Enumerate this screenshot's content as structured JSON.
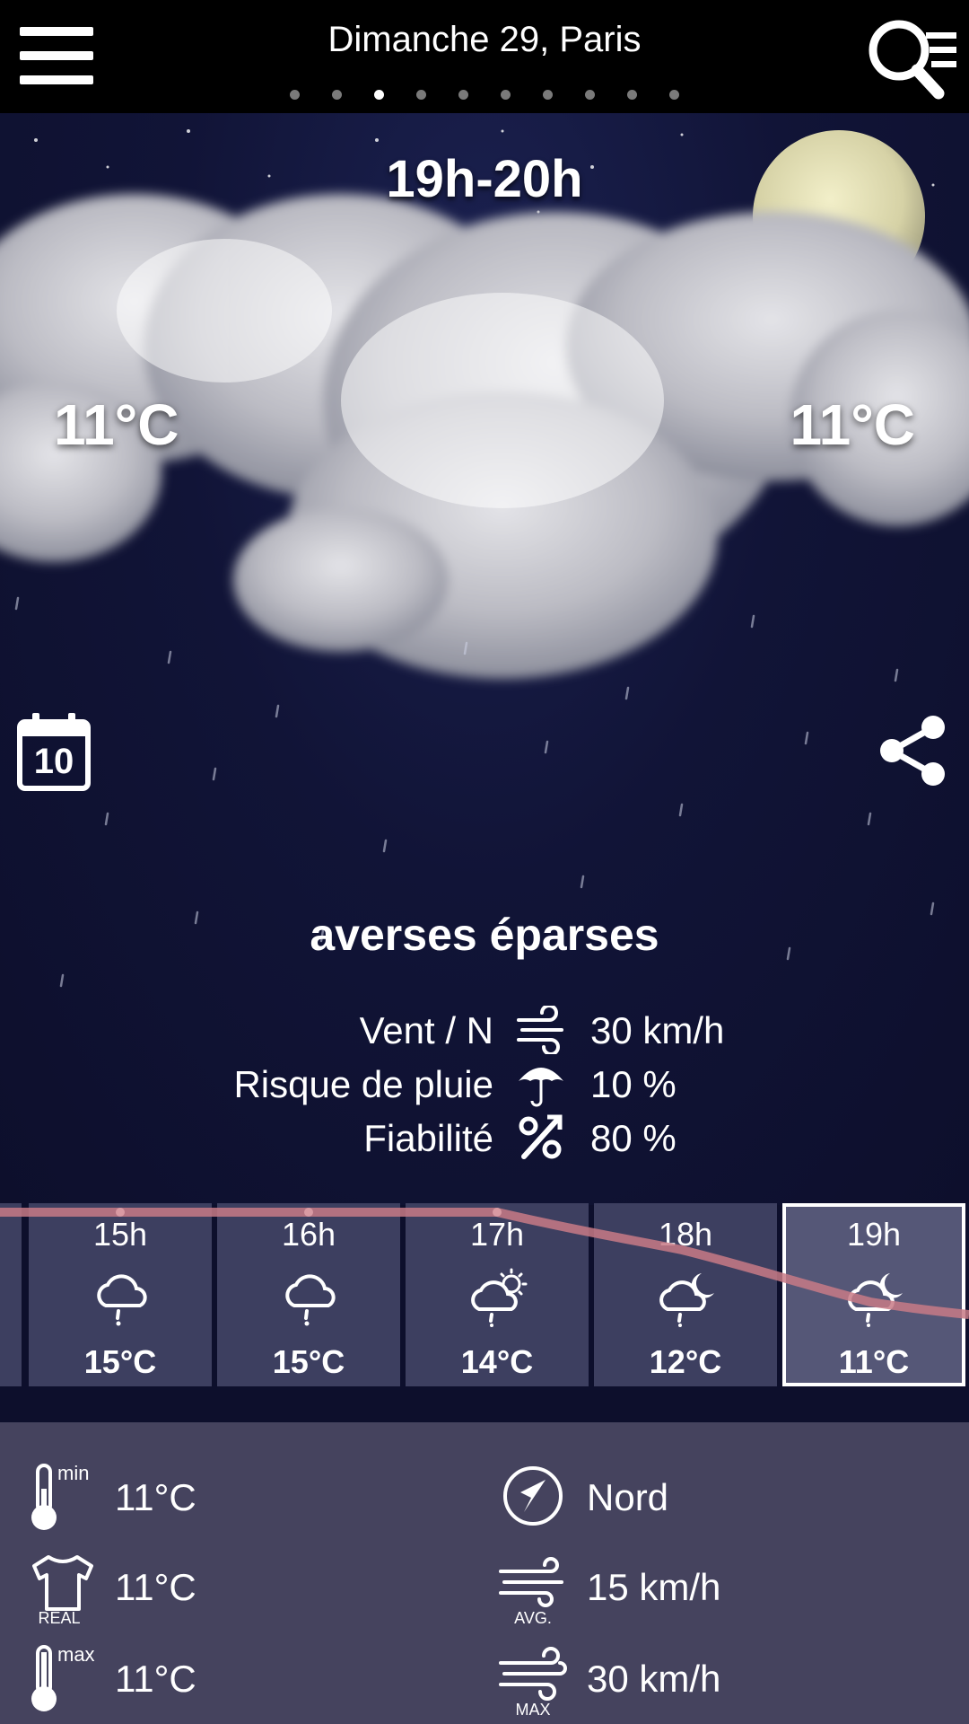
{
  "header": {
    "title": "Dimanche 29, Paris",
    "page_count": 10,
    "active_page": 3
  },
  "hero": {
    "time_range": "19h-20h",
    "temp_left": "11°C",
    "temp_right": "11°C",
    "calendar_label": "10",
    "condition": "averses éparses"
  },
  "details": [
    {
      "label": "Vent / N",
      "icon": "wind-icon",
      "value": "30 km/h"
    },
    {
      "label": "Risque de pluie",
      "icon": "umbrella-icon",
      "value": "10 %"
    },
    {
      "label": "Fiabilité",
      "icon": "percent-icon",
      "value": "80 %"
    }
  ],
  "hourly": [
    {
      "hour": "15h",
      "icon": "cloud-rain-icon",
      "temp": "15°C"
    },
    {
      "hour": "16h",
      "icon": "cloud-rain-icon",
      "temp": "15°C"
    },
    {
      "hour": "17h",
      "icon": "sun-cloud-rain-icon",
      "temp": "14°C"
    },
    {
      "hour": "18h",
      "icon": "moon-cloud-rain-icon",
      "temp": "12°C"
    },
    {
      "hour": "19h",
      "icon": "moon-cloud-rain-icon",
      "temp": "11°C",
      "selected": true
    }
  ],
  "stats": {
    "min": {
      "sup": "min",
      "value": "11°C"
    },
    "real": {
      "sub": "REAL",
      "value": "11°C"
    },
    "max": {
      "sup": "max",
      "value": "11°C"
    },
    "direction": {
      "value": "Nord"
    },
    "avg_wind": {
      "sub": "AVG.",
      "value": "15 km/h"
    },
    "max_wind": {
      "sub": "MAX",
      "value": "30 km/h"
    }
  },
  "colors": {
    "background": "#0d0f2c",
    "topbar": "#000000",
    "cell": "#3d3f60",
    "selected_cell": "#555777",
    "panel": "#45435e",
    "trend_line": "#c87a86"
  }
}
